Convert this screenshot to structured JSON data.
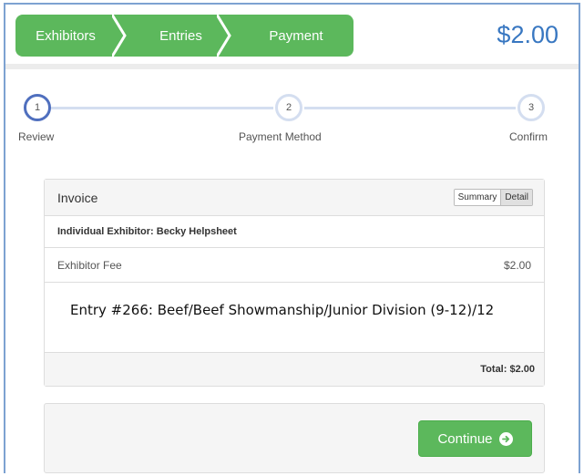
{
  "header": {
    "breadcrumbs": [
      {
        "label": "Exhibitors"
      },
      {
        "label": "Entries"
      },
      {
        "label": "Payment"
      }
    ],
    "total": "$2.00",
    "accent_color": "#5cb85c",
    "total_color": "#3877c1"
  },
  "stepper": {
    "current_step": 1,
    "steps": [
      {
        "number": "1",
        "label": "Review"
      },
      {
        "number": "2",
        "label": "Payment Method"
      },
      {
        "number": "3",
        "label": "Confirm"
      }
    ]
  },
  "invoice": {
    "title": "Invoice",
    "view_toggle": {
      "summary_label": "Summary",
      "detail_label": "Detail",
      "selected": "Detail"
    },
    "exhibitor_label": "Individual Exhibitor: Becky Helpsheet",
    "fee": {
      "label": "Exhibitor Fee",
      "amount": "$2.00"
    },
    "entry_text": "Entry #266: Beef/Beef Showmanship/Junior Division (9-12)/12",
    "total_label": "Total: $2.00"
  },
  "actions": {
    "continue_label": "Continue",
    "continue_icon": "arrow-circle-right-icon"
  }
}
